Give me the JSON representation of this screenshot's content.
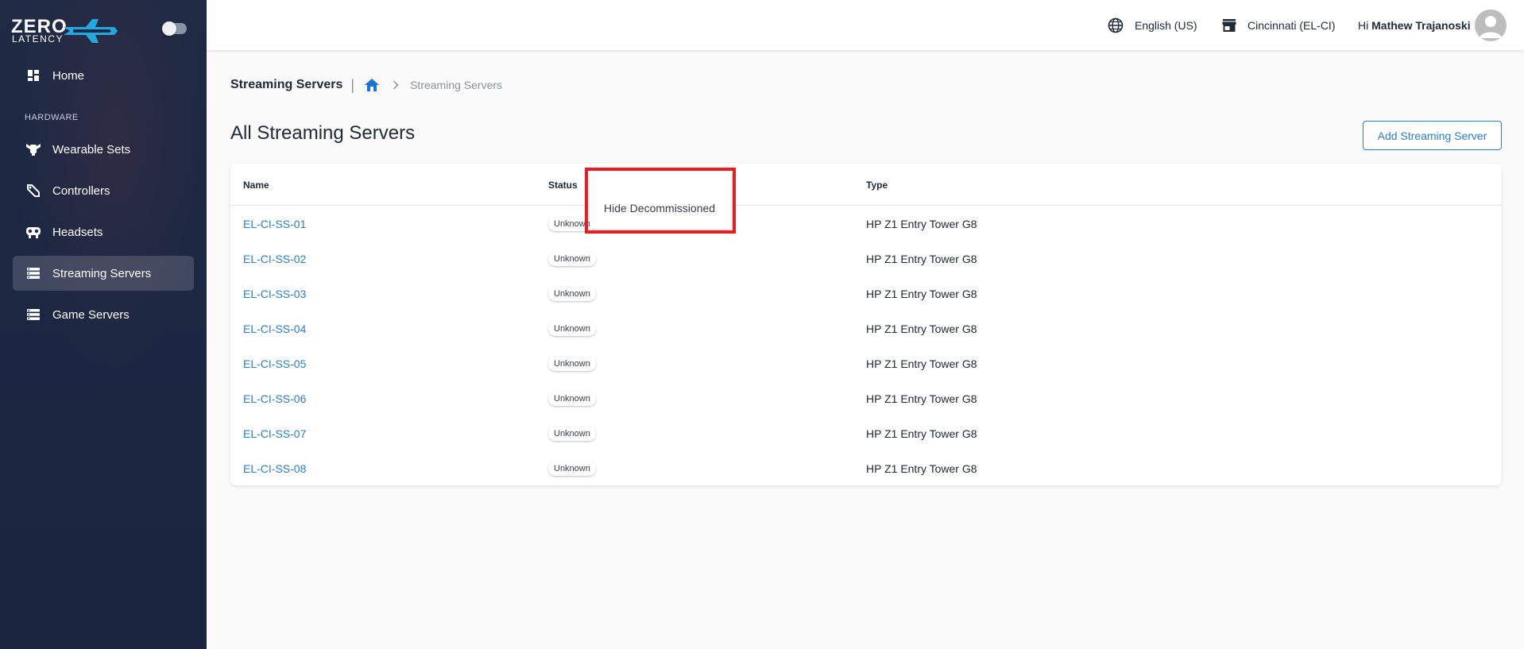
{
  "brand": {
    "line1": "ZERO",
    "line2": "LATENCY"
  },
  "sidebar": {
    "section_label": "HARDWARE",
    "items": [
      {
        "label": "Home",
        "icon": "dashboard-icon"
      },
      {
        "label": "Wearable Sets",
        "icon": "wearable-set-icon"
      },
      {
        "label": "Controllers",
        "icon": "controller-icon"
      },
      {
        "label": "Headsets",
        "icon": "headset-icon"
      },
      {
        "label": "Streaming Servers",
        "icon": "server-icon",
        "active": true
      },
      {
        "label": "Game Servers",
        "icon": "server-icon"
      }
    ]
  },
  "topbar": {
    "language": "English (US)",
    "location": "Cincinnati (EL-CI)",
    "greeting": "Hi",
    "user_name": "Mathew Trajanoski"
  },
  "breadcrumb": {
    "title": "Streaming Servers",
    "separator": "|",
    "current": "Streaming Servers"
  },
  "page": {
    "title": "All Streaming Servers",
    "add_button": "Add Streaming Server"
  },
  "table": {
    "columns": {
      "name": "Name",
      "status": "Status",
      "type": "Type"
    },
    "rows": [
      {
        "name": "EL-CI-SS-01",
        "status": "Unknown",
        "type": "HP Z1 Entry Tower G8"
      },
      {
        "name": "EL-CI-SS-02",
        "status": "Unknown",
        "type": "HP Z1 Entry Tower G8"
      },
      {
        "name": "EL-CI-SS-03",
        "status": "Unknown",
        "type": "HP Z1 Entry Tower G8"
      },
      {
        "name": "EL-CI-SS-04",
        "status": "Unknown",
        "type": "HP Z1 Entry Tower G8"
      },
      {
        "name": "EL-CI-SS-05",
        "status": "Unknown",
        "type": "HP Z1 Entry Tower G8"
      },
      {
        "name": "EL-CI-SS-06",
        "status": "Unknown",
        "type": "HP Z1 Entry Tower G8"
      },
      {
        "name": "EL-CI-SS-07",
        "status": "Unknown",
        "type": "HP Z1 Entry Tower G8"
      },
      {
        "name": "EL-CI-SS-08",
        "status": "Unknown",
        "type": "HP Z1 Entry Tower G8"
      }
    ]
  },
  "status_menu": {
    "items": [
      {
        "label": "Hide Decommissioned"
      }
    ]
  },
  "colors": {
    "sidebar_bg": "#1f2a44",
    "link": "#2d7fc9",
    "highlight": "#e41e22"
  }
}
